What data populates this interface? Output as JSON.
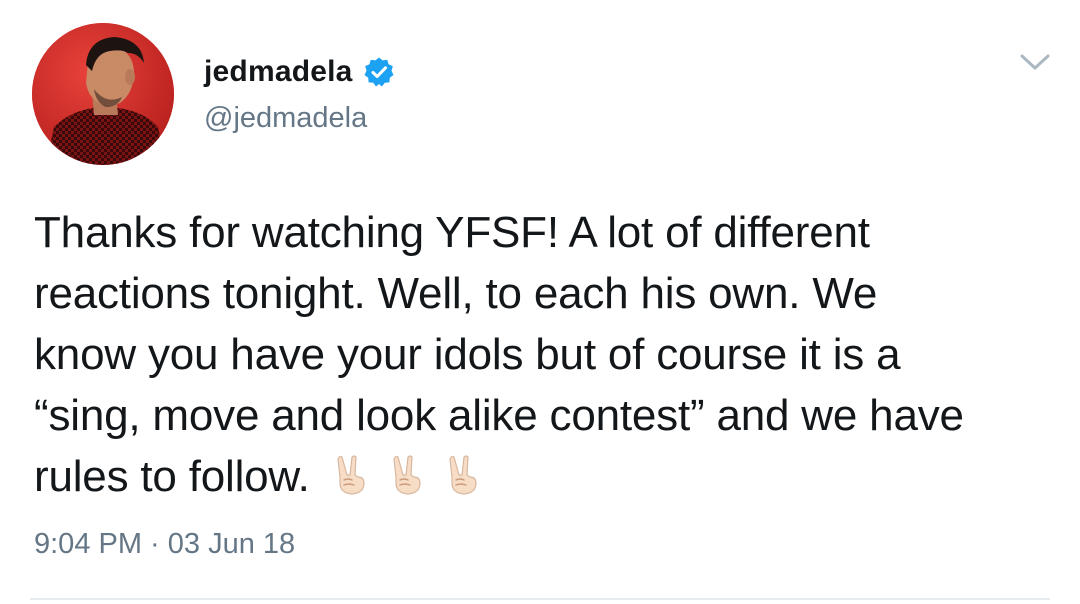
{
  "author": {
    "display_name": "jedmadela",
    "handle": "@jedmadela",
    "verified": true
  },
  "tweet": {
    "line1": "Thanks for watching YFSF! A lot of different",
    "line2": "reactions tonight. Well, to each his own. We",
    "line3": "know you have your idols but of course it is a",
    "line4": "“sing, move and look alike contest” and we have",
    "line5": "rules to follow.",
    "emojis": [
      "victory-hand",
      "victory-hand",
      "victory-hand"
    ],
    "timestamp": "9:04 PM · 03 Jun 18"
  },
  "icons": {
    "verified": "verified-badge-icon",
    "menu": "chevron-down-icon"
  },
  "colors": {
    "text": "#14171a",
    "secondary": "#657786",
    "verified_blue": "#1da1f2",
    "avatar_bg": "#d62a27"
  }
}
